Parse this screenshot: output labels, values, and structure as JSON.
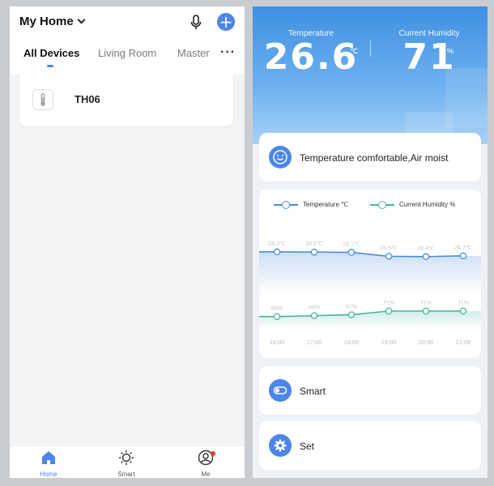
{
  "left": {
    "home_title": "My Home",
    "tabs": [
      {
        "label": "All Devices",
        "active": true
      },
      {
        "label": "Living Room",
        "active": false
      },
      {
        "label": "Master",
        "active": false
      }
    ],
    "more_label": "···",
    "devices": [
      {
        "name": "TH06"
      }
    ],
    "nav": [
      {
        "label": "Home",
        "icon": "home-icon",
        "active": true
      },
      {
        "label": "Smart",
        "icon": "sun-icon",
        "active": false
      },
      {
        "label": "Me",
        "icon": "user-icon",
        "active": false
      }
    ]
  },
  "right": {
    "temperature": {
      "label": "Temperature",
      "value": "26.6",
      "unit": "℃"
    },
    "humidity": {
      "label": "Current Humidity",
      "value": "71",
      "unit": "%"
    },
    "comfort_text": "Temperature comfortable,Air moist",
    "smart_label": "Smart",
    "set_label": "Set",
    "colors": {
      "temp": "#4b8ed6",
      "humidity": "#46b59a",
      "accent": "#4b86e8"
    }
  },
  "chart_data": {
    "type": "line",
    "x": [
      "16:00",
      "17:00",
      "18:00",
      "19:00",
      "20:00",
      "21:00"
    ],
    "series": [
      {
        "name": "Temperature ℃",
        "values": [
          28.3,
          28.2,
          28.1,
          26.5,
          26.4,
          26.7
        ],
        "labels": [
          "28.3℃",
          "28.2℃",
          "28.1℃",
          "26.5℃",
          "26.4℃",
          "26.7℃"
        ]
      },
      {
        "name": "Current Humidity %",
        "values": [
          65,
          66,
          67,
          71,
          71,
          71
        ],
        "labels": [
          "65%",
          "66%",
          "67%",
          "71%",
          "71%",
          "71%"
        ]
      }
    ],
    "legend": "top"
  }
}
